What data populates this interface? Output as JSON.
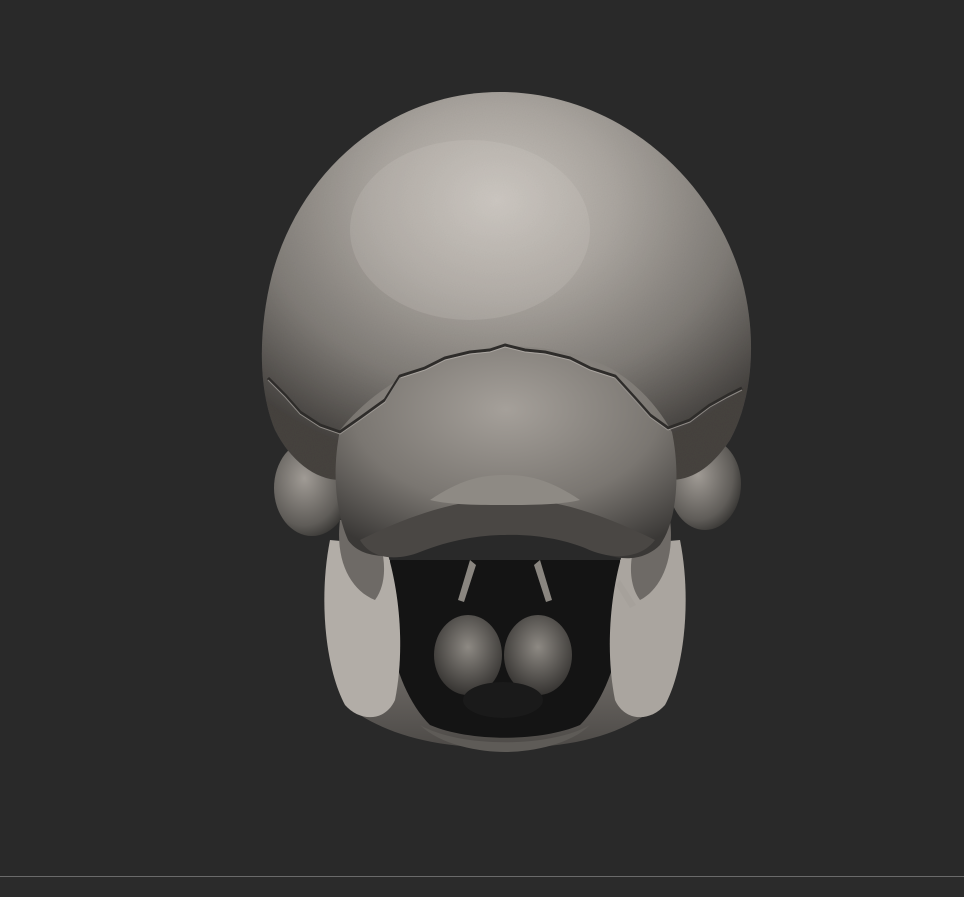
{
  "viewport": {
    "background": "#292929",
    "model": "skull-posterior-view"
  },
  "colors": {
    "bone_light": "#b9b4ae",
    "bone_mid": "#8d8983",
    "bone_dark": "#3e3c3a",
    "shadow": "#0f0f0f",
    "separator": "#6a6a6a"
  }
}
